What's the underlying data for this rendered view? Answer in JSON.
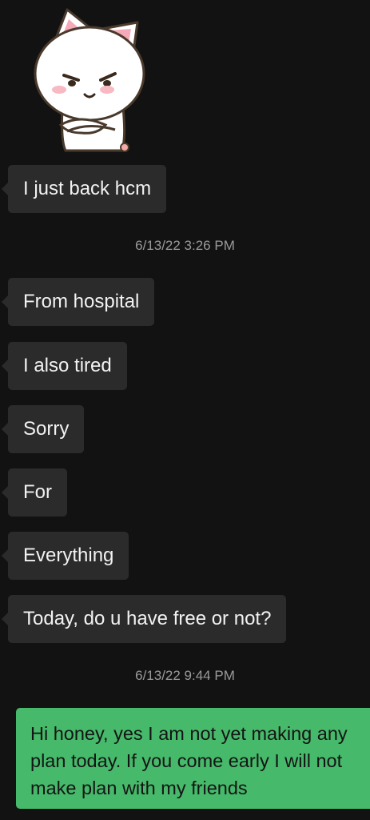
{
  "colors": {
    "background": "#121212",
    "incoming_bubble": "#2b2b2b",
    "outgoing_bubble": "#46b96a",
    "timestamp_text": "#9a9a9a"
  },
  "sticker": {
    "icon": "cat-sticker-icon"
  },
  "messages": [
    {
      "text": "I just back hcm"
    },
    {
      "text": "From hospital"
    },
    {
      "text": "I also tired"
    },
    {
      "text": "Sorry"
    },
    {
      "text": "For"
    },
    {
      "text": "Everything"
    },
    {
      "text": "Today, do u have free or not?"
    },
    {
      "text": "Hi honey, yes I am not yet making any plan today. If you come early I will not make plan with my friends"
    }
  ],
  "timestamps": [
    {
      "text": "6/13/22 3:26 PM"
    },
    {
      "text": "6/13/22 9:44 PM"
    }
  ]
}
